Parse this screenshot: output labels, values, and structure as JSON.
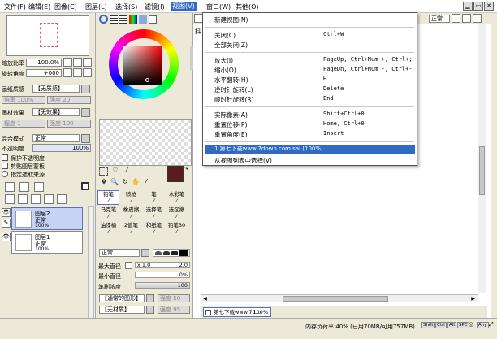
{
  "menubar": {
    "items": [
      "文件(F)",
      "编辑(E)",
      "图像(C)",
      "图层(L)",
      "选择(S)",
      "滤镜(I)",
      "视图(V)",
      "窗口(W)",
      "其他(O)"
    ]
  },
  "window_buttons": [
    "▁",
    "▭",
    "✕"
  ],
  "navigator": {
    "zoom_label": "缩放比率",
    "zoom_value": "100.0%",
    "rotate_label": "旋转角度",
    "rotate_value": "+000"
  },
  "texture": {
    "label": "画纸质感",
    "value": "【无质感】",
    "scale_label": "倍率",
    "scale_value": "100%",
    "strength_label": "强度",
    "strength_value": "20"
  },
  "effect": {
    "label": "画材效果",
    "value": "【无效果】",
    "amount_label": "程度",
    "amount_value": "1",
    "strength_label": "强度",
    "strength_value": "100"
  },
  "layer_props": {
    "blend_label": "混合模式",
    "blend_value": "正常",
    "opacity_label": "不透明度",
    "opacity_value": "100%",
    "options": [
      "保护不透明度",
      "剪贴图层蒙板",
      "指定选取来源"
    ]
  },
  "layers": [
    {
      "name": "图层2",
      "mode": "正常",
      "opacity": "100%"
    },
    {
      "name": "图层1",
      "mode": "正常",
      "opacity": "100%"
    }
  ],
  "tools": {
    "row1": [
      "铅笔",
      "喷枪",
      "笔",
      "水彩笔"
    ],
    "row2": [
      "马克笔",
      "橡皮擦",
      "选择笔",
      "选区擦"
    ],
    "row3": [
      "油漆桶",
      "2值笔",
      "和纸笔",
      "铅笔30"
    ],
    "mode_value": "正常",
    "max_size_label": "最大直径",
    "max_size_mult": "x 1.0",
    "max_size_value": "2.0",
    "min_size_label": "最小直径",
    "min_size_value": "0%",
    "density_label": "笔刷浓度",
    "density_value": "100",
    "shape_value": "【通常的图形】",
    "shape_strength_label": "强度",
    "shape_strength_value": "50",
    "material_value": "【无材质】",
    "material_strength_label": "强度",
    "material_strength_value": "95"
  },
  "canvas_toolbar": {
    "label": "抖",
    "mode_value": "正常"
  },
  "view_menu": {
    "items": [
      {
        "label": "新建视图(N)",
        "shortcut": ""
      },
      {
        "label": "关闭(C)",
        "shortcut": "Ctrl+W"
      },
      {
        "label": "全部关闭(Z)",
        "shortcut": ""
      },
      {
        "label": "放大(I)",
        "shortcut": "PageUp, Ctrl+Num +, Ctrl+;"
      },
      {
        "label": "缩小(O)",
        "shortcut": "PageDn, Ctrl+Num -, Ctrl+-"
      },
      {
        "label": "水平翻转(H)",
        "shortcut": "H"
      },
      {
        "label": "逆时针旋转(L)",
        "shortcut": "Delete"
      },
      {
        "label": "顺时针旋转(R)",
        "shortcut": "End"
      },
      {
        "label": "实际像素(A)",
        "shortcut": "Shift+Ctrl+0"
      },
      {
        "label": "重置位移(P)",
        "shortcut": "Home, Ctrl+0"
      },
      {
        "label": "重置角度(E)",
        "shortcut": "Insert"
      },
      {
        "label": "1 第七下载www.7down.com.sai (100%)",
        "shortcut": ""
      },
      {
        "label": "从视图列表中选择(V)",
        "shortcut": ""
      }
    ]
  },
  "tab": {
    "label": "第七下载www.7d...",
    "zoom": "100%"
  },
  "status": {
    "memory": "内存负荷率:40% (已用70MB/可用757MB)",
    "keys": [
      "Shift",
      "Ctrl",
      "Alt",
      "SPC",
      "◎",
      "Any",
      "⤢"
    ]
  }
}
